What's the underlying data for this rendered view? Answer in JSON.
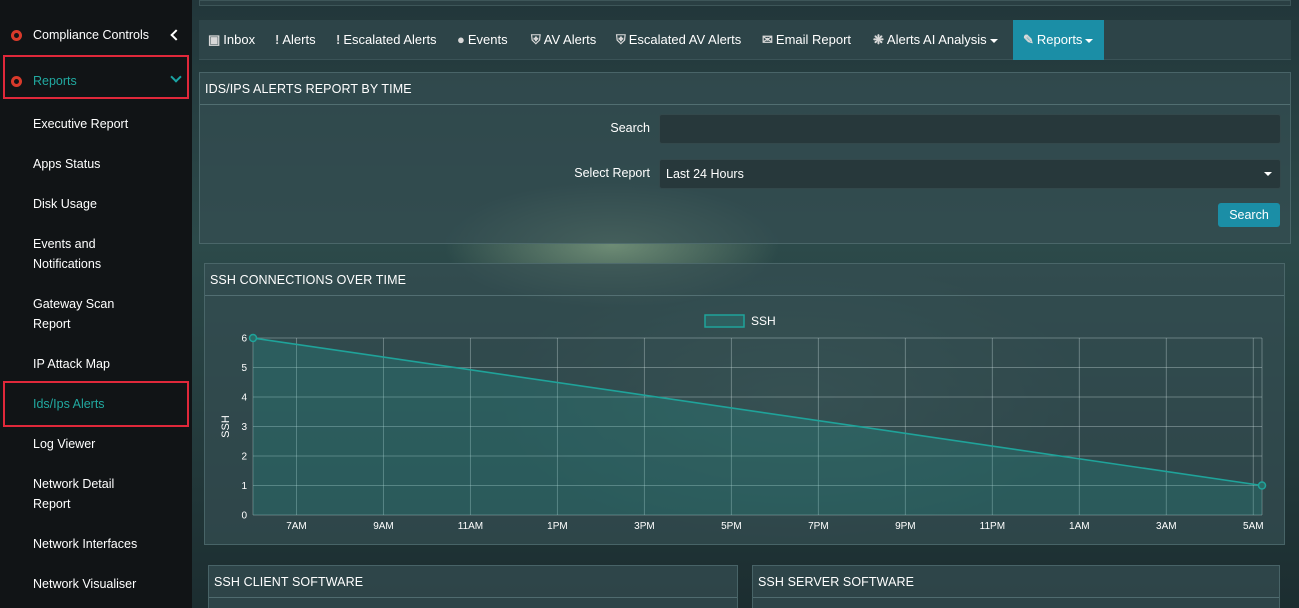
{
  "sidebar": {
    "compliance": "Compliance Controls",
    "reports": "Reports",
    "items": [
      {
        "label": "Executive Report"
      },
      {
        "label": "Apps Status"
      },
      {
        "label": "Disk Usage"
      },
      {
        "label": "Events and Notifications"
      },
      {
        "label": "Gateway Scan Report"
      },
      {
        "label": "IP Attack Map"
      },
      {
        "label": "Ids/Ips Alerts"
      },
      {
        "label": "Log Viewer"
      },
      {
        "label": "Network Detail Report"
      },
      {
        "label": "Network Interfaces"
      },
      {
        "label": "Network Visualiser"
      }
    ]
  },
  "tabs": {
    "inbox": "Inbox",
    "alerts": "Alerts",
    "escalated_alerts": "Escalated Alerts",
    "events": "Events",
    "av_alerts": "AV Alerts",
    "escalated_av_alerts": "Escalated AV Alerts",
    "email_report": "Email Report",
    "ai_analysis": "Alerts AI Analysis",
    "reports": "Reports"
  },
  "report_panel": {
    "title": "IDS/IPS ALERTS REPORT BY TIME",
    "search_label": "Search",
    "search_value": "",
    "select_label": "Select Report",
    "select_value": "Last 24 Hours",
    "search_button": "Search"
  },
  "chart_panel": {
    "title": "SSH CONNECTIONS OVER TIME"
  },
  "chart_data": {
    "type": "line",
    "title": "SSH CONNECTIONS OVER TIME",
    "ylabel": "SSH",
    "xlabel": "",
    "x_ticks": [
      "7AM",
      "9AM",
      "11AM",
      "1PM",
      "3PM",
      "5PM",
      "7PM",
      "9PM",
      "11PM",
      "1AM",
      "3AM",
      "5AM"
    ],
    "y_ticks": [
      "0",
      "1",
      "2",
      "3",
      "4",
      "5",
      "6"
    ],
    "ylim": [
      0,
      6
    ],
    "xlim": [
      6,
      29.2
    ],
    "legend_position": "top-center",
    "grid": true,
    "series": [
      {
        "name": "SSH",
        "color": "#1fa39a",
        "points": [
          {
            "x": 6,
            "y": 6
          },
          {
            "x": 29.2,
            "y": 1
          }
        ]
      }
    ]
  },
  "client_panel": {
    "title": "SSH CLIENT SOFTWARE"
  },
  "server_panel": {
    "title": "SSH SERVER SOFTWARE"
  },
  "colors": {
    "accent": "#1b8ea6",
    "highlight": "#e0283a",
    "active_text": "#21a9a0",
    "line": "#1fa39a"
  }
}
